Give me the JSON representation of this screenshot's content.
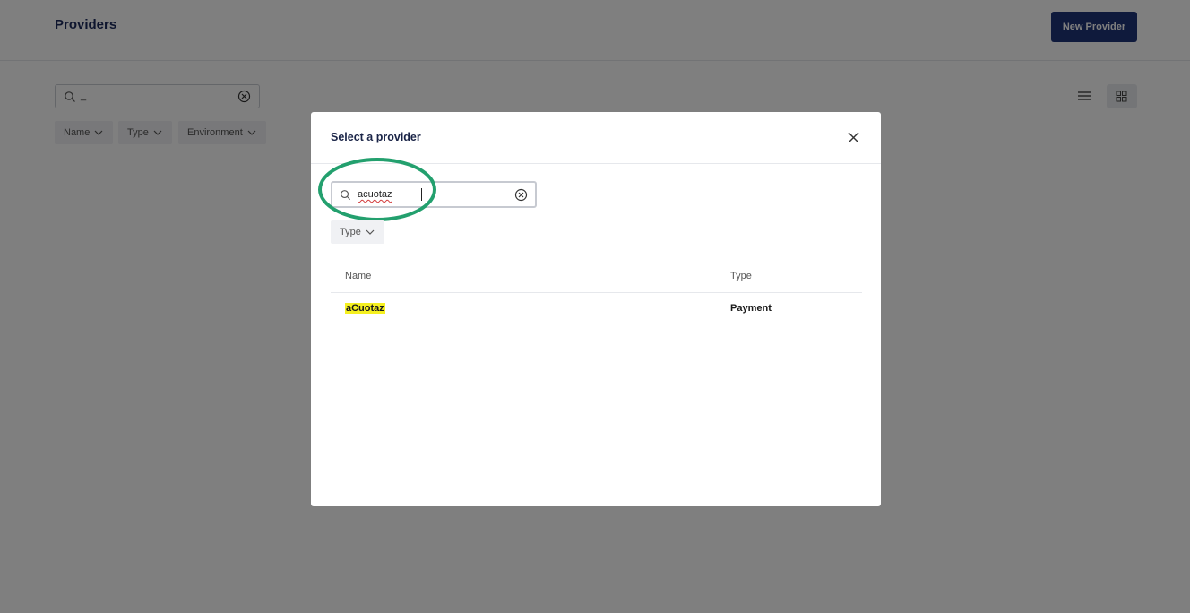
{
  "header": {
    "title": "Providers",
    "new_provider_label": "New Provider"
  },
  "search": {
    "value": "_"
  },
  "filters": [
    {
      "label": "Name"
    },
    {
      "label": "Type"
    },
    {
      "label": "Environment"
    }
  ],
  "view_toggle": {
    "active": "grid"
  },
  "modal": {
    "title": "Select a provider",
    "search_value": "acuotaz",
    "type_filter_label": "Type",
    "columns": {
      "name": "Name",
      "type": "Type"
    },
    "rows": [
      {
        "name": "aCuotaz",
        "type": "Payment"
      }
    ]
  },
  "colors": {
    "brand": "#1f3478",
    "highlight": "#f5f020",
    "annotation": "#23a06e"
  }
}
